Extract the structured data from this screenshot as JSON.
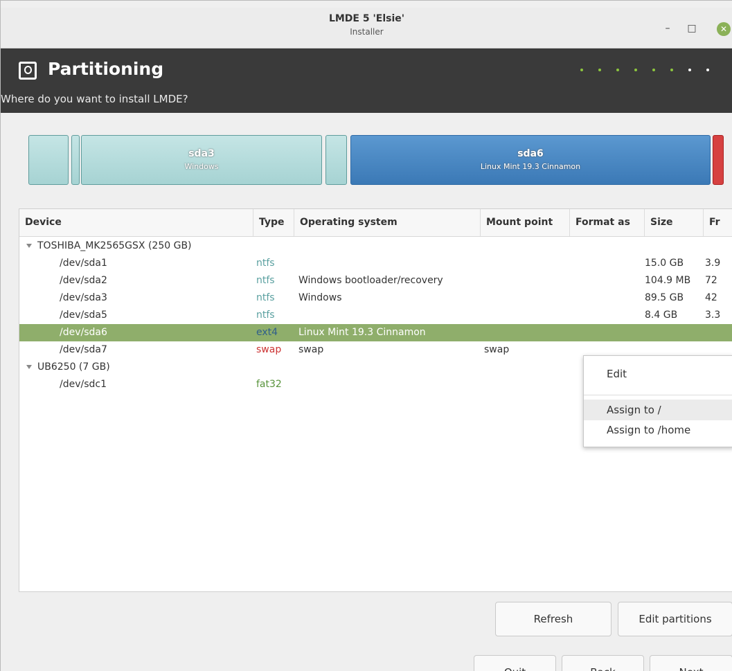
{
  "window": {
    "title": "LMDE 5 'Elsie'",
    "subtitle": "Installer",
    "minimize_icon": "minimize-icon",
    "maximize_icon": "maximize-icon",
    "close_icon": "close-icon",
    "close_color": "#8bb158"
  },
  "header": {
    "title": "Partitioning",
    "subtitle": "Where do you want to install LMDE?",
    "icon": "disk-partition-icon",
    "progress_dots_total": 8,
    "progress_dots_done": 6,
    "dot_color_done": "#8dc63f",
    "dot_color_pending": "#ffffff"
  },
  "diskbar": {
    "segments": [
      {
        "name": "",
        "label": "",
        "color": "teal"
      },
      {
        "name": "",
        "label": "",
        "color": "teal"
      },
      {
        "name": "sda3",
        "label": "Windows",
        "color": "teal"
      },
      {
        "name": "",
        "label": "",
        "color": "teal"
      },
      {
        "name": "sda6",
        "label": "Linux Mint 19.3 Cinnamon",
        "color": "blue"
      },
      {
        "name": "",
        "label": "",
        "color": "red"
      }
    ]
  },
  "table": {
    "columns": [
      "Device",
      "Type",
      "Operating system",
      "Mount point",
      "Format as",
      "Size",
      "Fr"
    ],
    "groups": [
      {
        "label": "TOSHIBA_MK2565GSX (250 GB)",
        "rows": [
          {
            "device": "/dev/sda1",
            "type": "ntfs",
            "os": "",
            "mount": "",
            "format": "",
            "size": "15.0 GB",
            "free": "3.9"
          },
          {
            "device": "/dev/sda2",
            "type": "ntfs",
            "os": "Windows bootloader/recovery",
            "mount": "",
            "format": "",
            "size": "104.9 MB",
            "free": "72"
          },
          {
            "device": "/dev/sda3",
            "type": "ntfs",
            "os": "Windows",
            "mount": "",
            "format": "",
            "size": "89.5 GB",
            "free": "42"
          },
          {
            "device": "/dev/sda5",
            "type": "ntfs",
            "os": "",
            "mount": "",
            "format": "",
            "size": "8.4 GB",
            "free": "3.3"
          },
          {
            "device": "/dev/sda6",
            "type": "ext4",
            "os": "Linux Mint 19.3 Cinnamon",
            "mount": "",
            "format": "",
            "size": "",
            "free": "",
            "selected": true
          },
          {
            "device": "/dev/sda7",
            "type": "swap",
            "os": "swap",
            "mount": "swap",
            "format": "",
            "size": "",
            "free": ""
          }
        ]
      },
      {
        "label": "UB6250 (7 GB)",
        "rows": [
          {
            "device": "/dev/sdc1",
            "type": "fat32",
            "os": "",
            "mount": "",
            "format": "",
            "size": "",
            "free": ""
          }
        ]
      }
    ],
    "expander_icon": "expander-down-icon",
    "selected_color": "#8fae6b"
  },
  "context_menu": {
    "items": [
      "Edit",
      "Assign to /",
      "Assign to /home"
    ],
    "hovered": "Assign to /"
  },
  "buttons": {
    "refresh": "Refresh",
    "edit_partitions": "Edit partitions",
    "quit": "Quit",
    "back": "Back",
    "next": "Next"
  }
}
